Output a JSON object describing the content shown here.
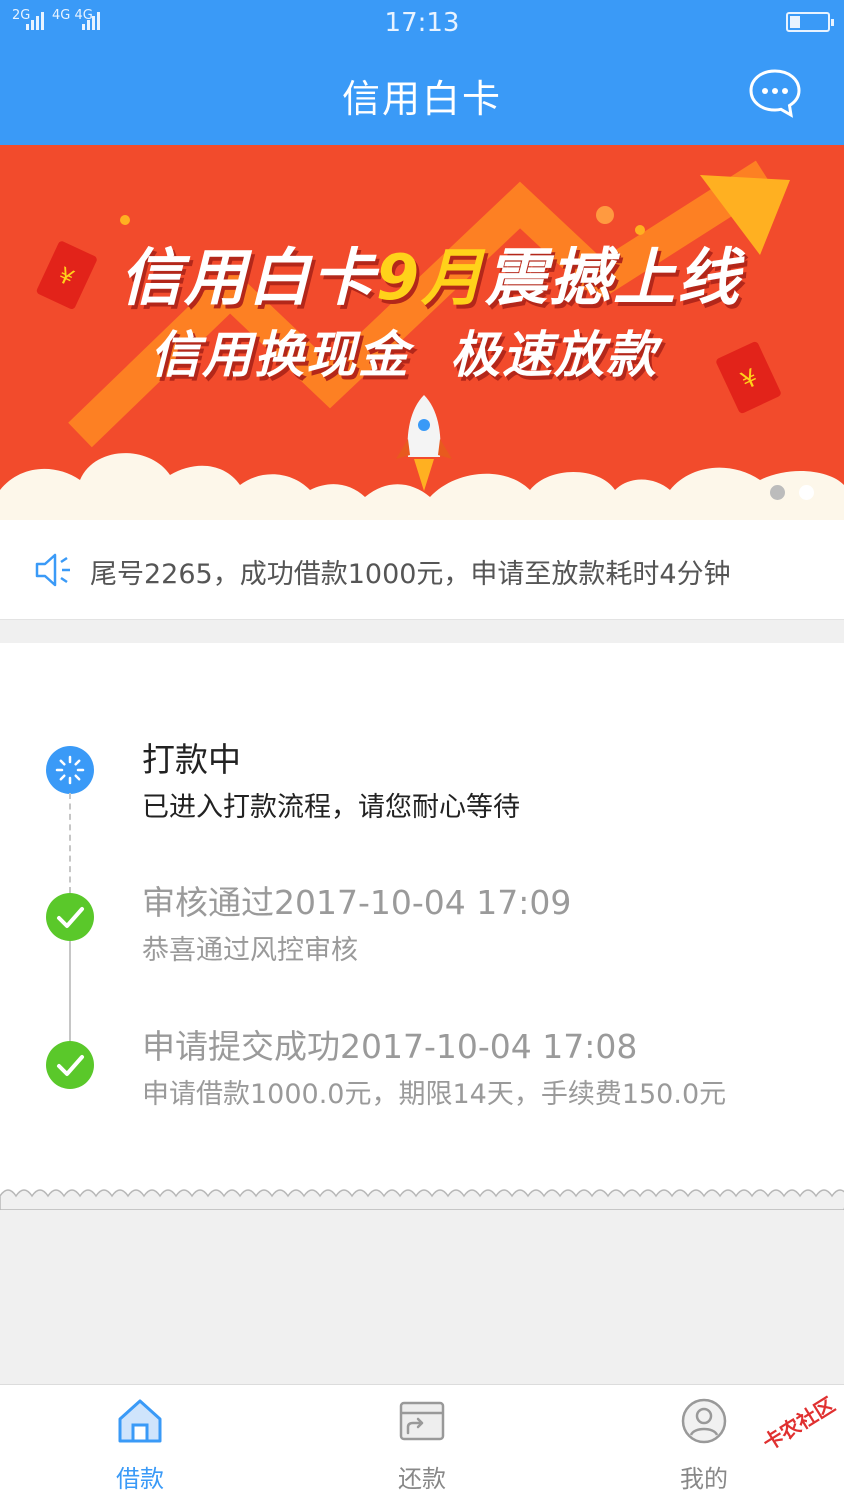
{
  "status_bar": {
    "signal1": "2G",
    "signal2": "4G 4G",
    "time": "17:13"
  },
  "header": {
    "title": "信用白卡",
    "chat_icon": "chat-bubble-icon"
  },
  "banner": {
    "line1_a": "信用白卡",
    "line1_b": "9月",
    "line1_c": "震撼上线",
    "line2_a": "信用换现金",
    "line2_b": "极速放款",
    "slides": 2,
    "active_slide": 2
  },
  "notice": {
    "icon": "speaker-icon",
    "text": "尾号2265，成功借款1000元，申请至放款耗时4分钟"
  },
  "progress": {
    "steps": [
      {
        "title": "打款中",
        "subtitle": "已进入打款流程，请您耐心等待",
        "state": "active"
      },
      {
        "title": "审核通过2017-10-04 17:09",
        "subtitle": "恭喜通过风控审核",
        "state": "done"
      },
      {
        "title": "申请提交成功2017-10-04 17:08",
        "subtitle": "申请借款1000.0元，期限14天，手续费150.0元",
        "state": "done"
      }
    ]
  },
  "nav": {
    "items": [
      {
        "label": "借款",
        "icon": "home-icon",
        "active": true
      },
      {
        "label": "还款",
        "icon": "repay-card-icon",
        "active": false
      },
      {
        "label": "我的",
        "icon": "user-profile-icon",
        "active": false
      }
    ]
  },
  "watermark": "卡农社区",
  "colors": {
    "primary": "#3a9af7",
    "banner_red": "#f24b2c",
    "success_green": "#5ac82a",
    "muted_text": "#9a9a9a"
  }
}
